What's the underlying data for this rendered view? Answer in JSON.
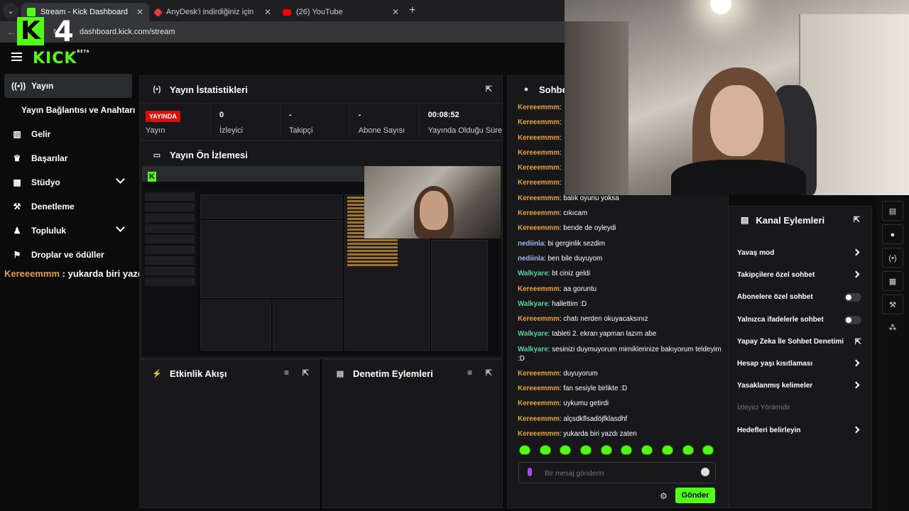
{
  "browser": {
    "tabs": [
      {
        "label": "Stream - Kick Dashboard",
        "color": "#53fc18"
      },
      {
        "label": "AnyDesk'i indirdiğiniz için teşek",
        "color": "#ef3a3a"
      },
      {
        "label": "(26) YouTube",
        "color": "#ff0000"
      }
    ],
    "url": "dashboard.kick.com/stream"
  },
  "brand": {
    "logo_letter": "K",
    "logo_number": "4",
    "wordmark": "KICK",
    "beta": "BETA",
    "accent": "#53fc18"
  },
  "sidebar": {
    "items": [
      {
        "label": "Yayın",
        "icon": "broadcast-icon"
      },
      {
        "label": "Yayın Bağlantısı ve Anahtarı"
      },
      {
        "label": "Gelir",
        "icon": "bar-chart-icon"
      },
      {
        "label": "Başarılar",
        "icon": "trophy-icon"
      },
      {
        "label": "Stüdyo",
        "icon": "layout-icon"
      },
      {
        "label": "Denetleme",
        "icon": "wrench-icon"
      },
      {
        "label": "Topluluk",
        "icon": "users-icon"
      },
      {
        "label": "Droplar ve ödüller",
        "icon": "gift-icon"
      }
    ]
  },
  "overlay_chat": {
    "user": "Kereeemmm",
    "text": " : yukarda biri yazdı zaten"
  },
  "stats_panel": {
    "title": "Yayın İstatistikleri",
    "stats": [
      {
        "value": "YAYINDA",
        "label": "Yayın"
      },
      {
        "value": "0",
        "label": "İzleyici"
      },
      {
        "value": "-",
        "label": "Takipçi"
      },
      {
        "value": "-",
        "label": "Abone Sayısı"
      },
      {
        "value": "00:08:52",
        "label": "Yayında Olduğu Süre"
      }
    ]
  },
  "preview_panel": {
    "title": "Yayın Ön İzlemesi"
  },
  "activity_panel": {
    "title": "Etkinlik Akışı"
  },
  "mod_panel": {
    "title": "Denetim Eylemleri"
  },
  "chat": {
    "title": "Sohbet",
    "messages": [
      {
        "user": "Kereeemmm",
        "text": "",
        "color": "#e8a23b"
      },
      {
        "user": "Kereeemmm",
        "text": "",
        "color": "#e8a23b"
      },
      {
        "user": "Kereeemmm",
        "text": "",
        "color": "#e8a23b"
      },
      {
        "user": "Kereeemmm",
        "text": "",
        "color": "#e8a23b"
      },
      {
        "user": "Kereeemmm",
        "text": "",
        "color": "#e8a23b"
      },
      {
        "user": "Kereeemmm",
        "text": "",
        "color": "#e8a23b"
      },
      {
        "user": "Kereeemmm",
        "text": "balık oyunu yoksa",
        "color": "#e8a23b"
      },
      {
        "user": "Kereeemmm",
        "text": "cıkıcam",
        "color": "#e8a23b"
      },
      {
        "user": "Kereeemmm",
        "text": "bende de oyleydi",
        "color": "#e8a23b"
      },
      {
        "user": "nediinla",
        "text": "bi gerginlik sezdim",
        "color": "#9db7f2"
      },
      {
        "user": "nediinla",
        "text": "ben bile duyuyom",
        "color": "#9db7f2"
      },
      {
        "user": "Walkyare",
        "text": "bt ciniz geldi",
        "color": "#53d4a0"
      },
      {
        "user": "Kereeemmm",
        "text": "aa goruntu",
        "color": "#e8a23b"
      },
      {
        "user": "Walkyare",
        "text": "hallettim :D",
        "color": "#53d4a0"
      },
      {
        "user": "Kereeemmm",
        "text": "chatı nerden okuyacaksınız",
        "color": "#e8a23b"
      },
      {
        "user": "Walkyare",
        "text": "tableti 2. ekran yapman lazım abe",
        "color": "#53d4a0"
      },
      {
        "user": "Walkyare",
        "text": "sesinizi duymuyorum mimiklerinize bakıyorum teldeyim :D",
        "color": "#53d4a0"
      },
      {
        "user": "Kereeemmm",
        "text": "duyuyorum",
        "color": "#e8a23b"
      },
      {
        "user": "Kereeemmm",
        "text": "fan sesiyle birlikte :D",
        "color": "#e8a23b"
      },
      {
        "user": "Kereeemmm",
        "text": "uykumu getirdi",
        "color": "#e8a23b"
      },
      {
        "user": "Kereeemmm",
        "text": "alçsdkflsadöjfklasdhf",
        "color": "#e8a23b"
      },
      {
        "user": "Kereeemmm",
        "text": "yukarda biri yazdı zaten",
        "color": "#e8a23b"
      }
    ],
    "input_placeholder": "Bir mesaj gönderin",
    "send_label": "Gönder"
  },
  "channel_actions": {
    "title": "Kanal Eylemleri",
    "items": [
      {
        "label": "Yavaş mod",
        "control": "arrow"
      },
      {
        "label": "Takipçilere özel sohbet",
        "control": "arrow"
      },
      {
        "label": "Abonelere özel sohbet",
        "control": "toggle"
      },
      {
        "label": "Yalnızca ifadelerle sohbet",
        "control": "toggle"
      },
      {
        "label": "Yapay Zeka İle Sohbet Denetimi",
        "control": "external"
      },
      {
        "label": "Hesap yaşı kısıtlaması",
        "control": "arrow"
      },
      {
        "label": "Yasaklanmış kelimeler",
        "control": "arrow"
      },
      {
        "label": "İzleyici Yönlendir",
        "control": "none"
      },
      {
        "label": "Hedefleri belirleyin",
        "control": "arrow"
      }
    ]
  }
}
